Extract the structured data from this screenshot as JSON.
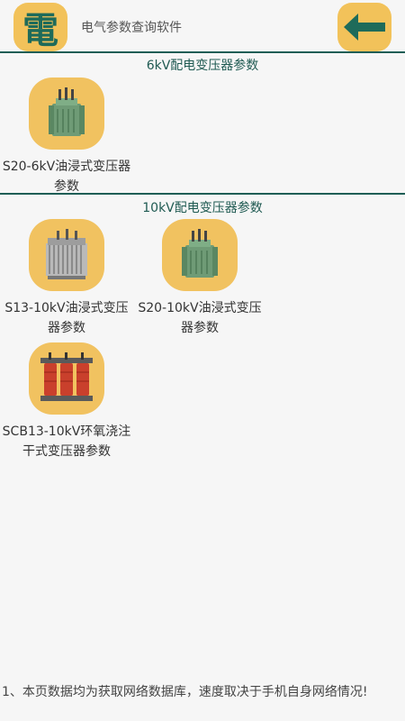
{
  "header": {
    "logo_char": "電",
    "title": "电气参数查询软件",
    "back_icon": "arrow-left-icon"
  },
  "sections": [
    {
      "title": "6kV配电变压器参数",
      "items": [
        {
          "label": "S20-6kV油浸式变压器参数",
          "icon": "oil-transformer-green-icon"
        }
      ]
    },
    {
      "title": "10kV配电变压器参数",
      "items": [
        {
          "label": "S13-10kV油浸式变压器参数",
          "icon": "oil-transformer-gray-icon"
        },
        {
          "label": "S20-10kV油浸式变压器参数",
          "icon": "oil-transformer-green-icon"
        },
        {
          "label": "SCB13-10kV环氧浇注干式变压器参数",
          "icon": "dry-transformer-red-icon"
        }
      ]
    }
  ],
  "footer": {
    "note": "1、本页数据均为获取网络数据库，速度取决于手机自身网络情况!"
  },
  "colors": {
    "accent": "#1f5e56",
    "tile": "#f1c260"
  }
}
